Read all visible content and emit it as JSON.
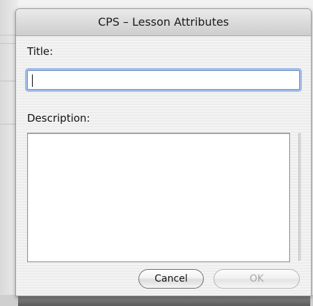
{
  "dialog": {
    "title": "CPS – Lesson Attributes",
    "title_label": "Title:",
    "title_value": "",
    "description_label": "Description:",
    "description_value": "",
    "cancel_label": "Cancel",
    "ok_label": "OK",
    "ok_enabled": false
  },
  "colors": {
    "focus_ring": "#9fbce6",
    "disabled_text": "#a6a6a6"
  }
}
